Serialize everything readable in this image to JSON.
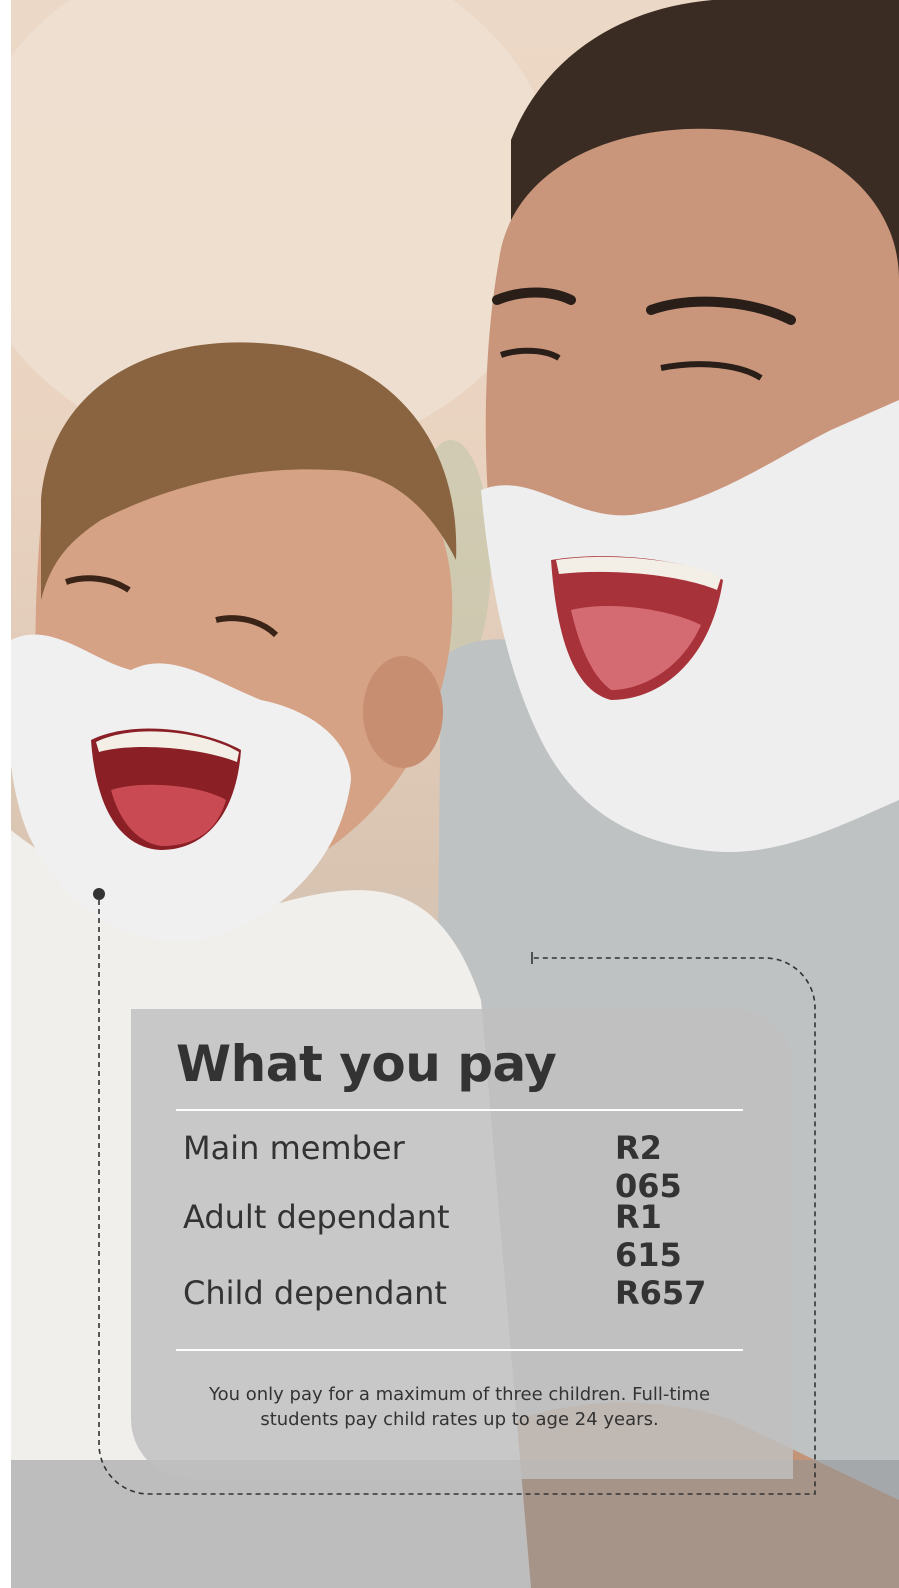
{
  "card": {
    "title": "What you pay",
    "rows": [
      {
        "label": "Main member",
        "price": "R2 065"
      },
      {
        "label": "Adult dependant",
        "price": "R1 615"
      },
      {
        "label": "Child dependant",
        "price": "R657"
      }
    ],
    "note": "You only pay for a maximum of three children. Full-time students pay child rates up to age 24 years."
  },
  "colors": {
    "text": "#333333",
    "card_background": "#c0c0c0",
    "rule": "#ffffff",
    "connector": "#333333"
  }
}
